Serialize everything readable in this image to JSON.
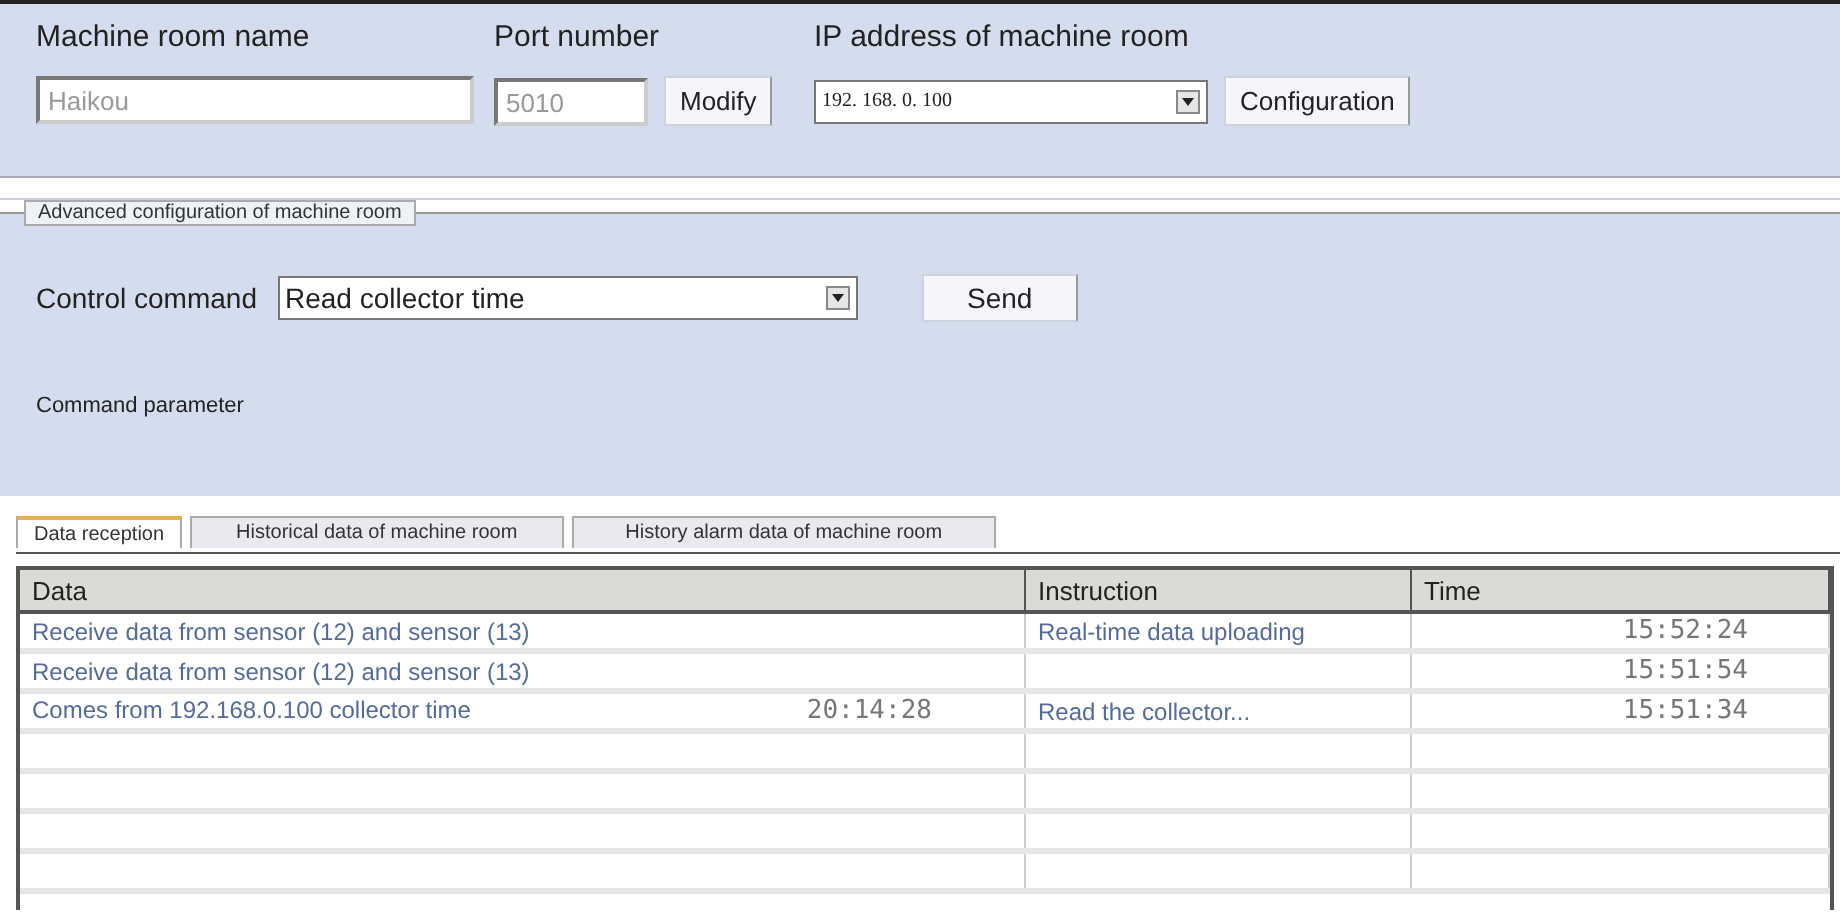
{
  "connection": {
    "name_label": "Machine room name",
    "name_value": "Haikou",
    "port_label": "Port number",
    "port_value": "5010",
    "modify_button": "Modify",
    "ip_label": "IP address of machine room",
    "ip_value": "192. 168. 0. 100",
    "configuration_button": "Configuration"
  },
  "advanced": {
    "title": "Advanced configuration of machine room",
    "command_label": "Control command",
    "command_value": "Read collector time",
    "send_button": "Send",
    "parameter_label": "Command parameter"
  },
  "tabs": [
    {
      "label": "Data reception",
      "selected": true
    },
    {
      "label": "Historical data of machine room",
      "selected": false
    },
    {
      "label": "History alarm data of machine room",
      "selected": false
    }
  ],
  "table": {
    "columns": [
      "Data",
      "Instruction",
      "Time"
    ],
    "rows": [
      {
        "data": "Receive data from sensor (12) and sensor (13)",
        "instruction": "Real-time data uploading",
        "time": "15:52:24"
      },
      {
        "data": "Receive data from sensor (12) and sensor (13)",
        "time": "15:51:54"
      },
      {
        "data": "Comes from 192.168.0.100 collector time",
        "data_time": "20:14:28",
        "instruction": "Read the collector...",
        "time": "15:51:34"
      }
    ]
  }
}
